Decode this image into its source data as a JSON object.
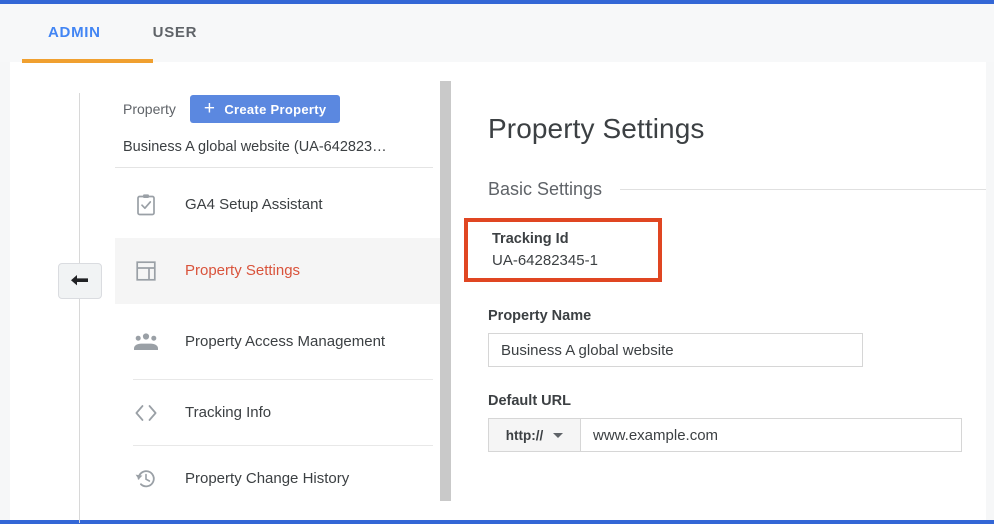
{
  "tabs": [
    {
      "label": "ADMIN",
      "active": true
    },
    {
      "label": "USER",
      "active": false
    }
  ],
  "sidebar": {
    "property_label": "Property",
    "create_button": "Create Property",
    "selected_property": "Business A global website (UA-642823…",
    "items": [
      {
        "label": "GA4 Setup Assistant",
        "icon": "clipboard-check-icon",
        "active": false
      },
      {
        "label": "Property Settings",
        "icon": "layout-icon",
        "active": true
      },
      {
        "label": "Property Access Management",
        "icon": "people-group-icon",
        "active": false
      },
      {
        "label": "Tracking Info",
        "icon": "code-brackets-icon",
        "active": false
      },
      {
        "label": "Property Change History",
        "icon": "history-restore-icon",
        "active": false
      }
    ]
  },
  "back_button": {
    "icon": "back-arrow-icon"
  },
  "main": {
    "title": "Property Settings",
    "section_title": "Basic Settings",
    "tracking_id": {
      "label": "Tracking Id",
      "value": "UA-64282345-1",
      "highlight_color": "#e04622"
    },
    "property_name": {
      "label": "Property Name",
      "value": "Business A global website"
    },
    "default_url": {
      "label": "Default URL",
      "protocol": "http://",
      "value": "www.example.com"
    }
  },
  "colors": {
    "tab_active": "#4285f4",
    "tab_underline": "#f0a030",
    "menu_active_text": "#d9533b",
    "button_blue": "#5b88e0",
    "browser_edge": "#3367d6"
  }
}
